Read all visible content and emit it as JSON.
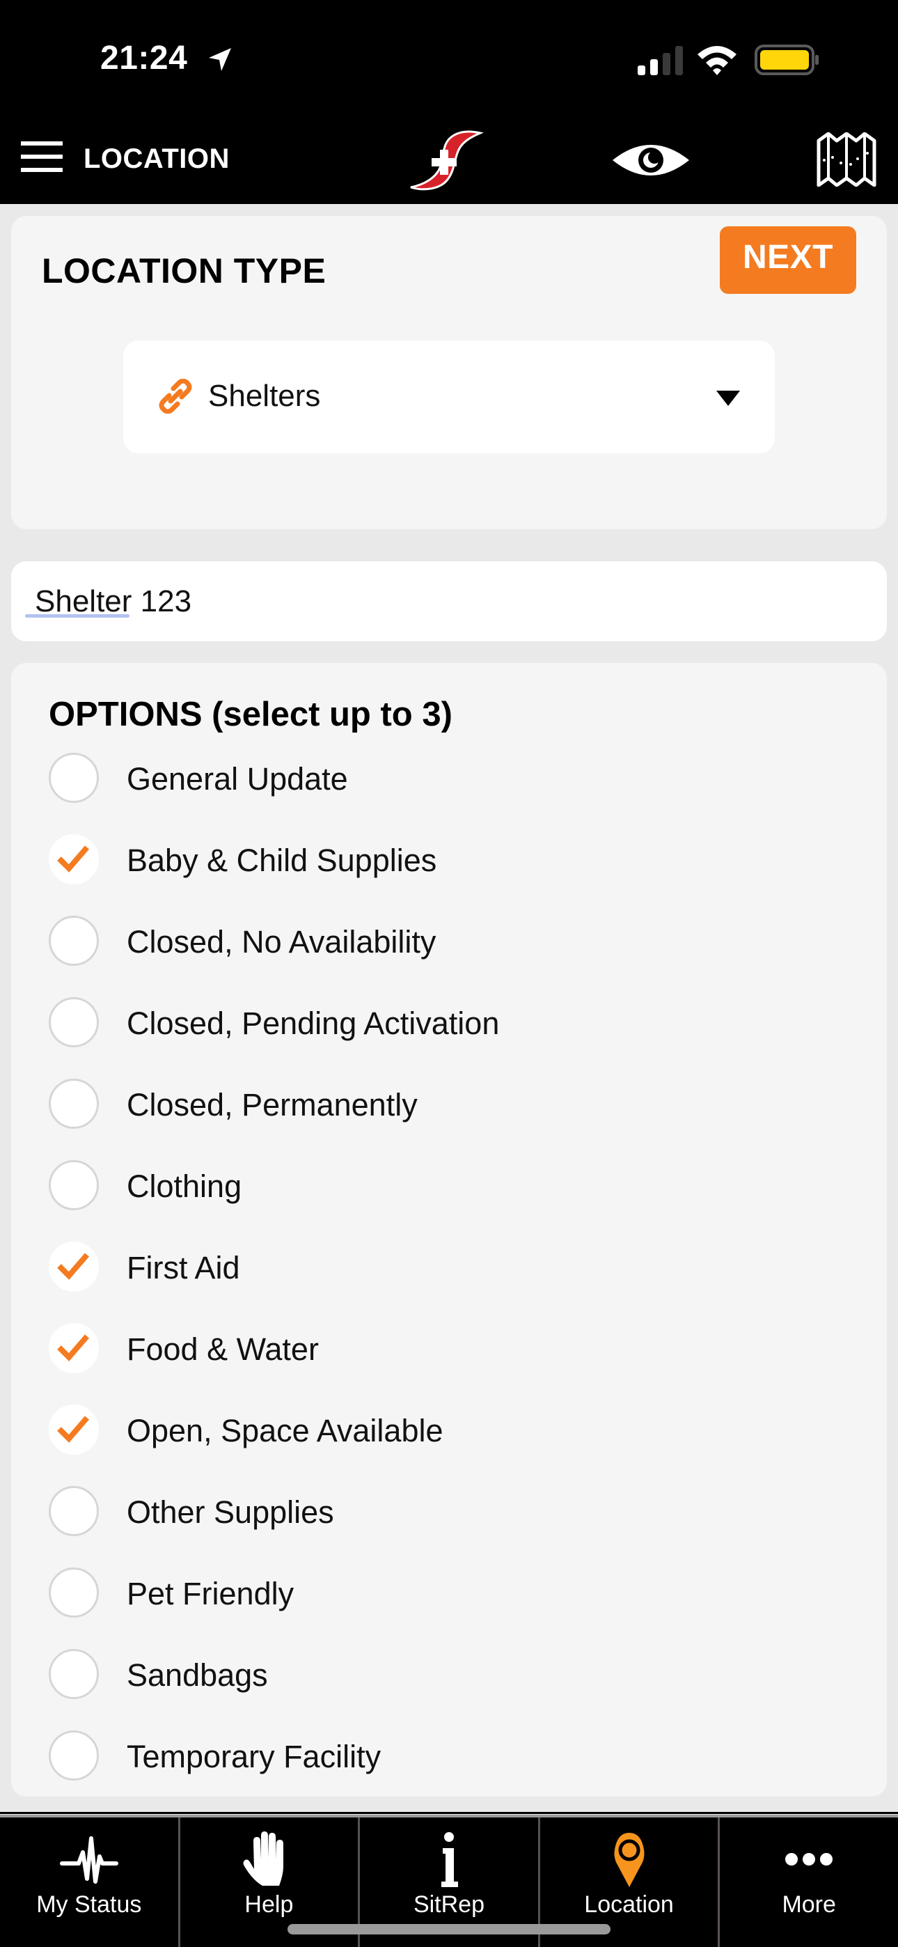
{
  "status_bar": {
    "time": "21:24",
    "battery_color": "#ffd60a"
  },
  "header": {
    "title": "LOCATION",
    "icons": [
      "menu-icon",
      "app-logo",
      "eye-icon",
      "map-icon"
    ]
  },
  "location_type": {
    "title": "LOCATION TYPE",
    "next_label": "NEXT",
    "selected": "Shelters",
    "dropdown_icon": "link-icon"
  },
  "name_field": {
    "value": "Shelter 123"
  },
  "options": {
    "title": "OPTIONS (select up to 3)",
    "items": [
      {
        "label": "General Update",
        "checked": false
      },
      {
        "label": "Baby & Child Supplies",
        "checked": true
      },
      {
        "label": "Closed, No Availability",
        "checked": false
      },
      {
        "label": "Closed, Pending Activation",
        "checked": false
      },
      {
        "label": "Closed, Permanently",
        "checked": false
      },
      {
        "label": "Clothing",
        "checked": false
      },
      {
        "label": "First Aid",
        "checked": true
      },
      {
        "label": "Food & Water",
        "checked": true
      },
      {
        "label": "Open, Space Available",
        "checked": true
      },
      {
        "label": "Other Supplies",
        "checked": false
      },
      {
        "label": "Pet Friendly",
        "checked": false
      },
      {
        "label": "Sandbags",
        "checked": false
      },
      {
        "label": "Temporary Facility",
        "checked": false
      }
    ]
  },
  "tabbar": {
    "items": [
      {
        "label": "My Status",
        "icon": "heartbeat-icon",
        "active": false
      },
      {
        "label": "Help",
        "icon": "hand-icon",
        "active": false
      },
      {
        "label": "SitRep",
        "icon": "info-icon",
        "active": false
      },
      {
        "label": "Location",
        "icon": "map-pin-icon",
        "active": true
      },
      {
        "label": "More",
        "icon": "more-dots-icon",
        "active": false
      }
    ]
  },
  "colors": {
    "accent": "#f47b20",
    "header_bg": "#000000",
    "card_bg": "#f5f5f5",
    "page_bg": "#e9e9e9",
    "logo_red": "#d6232a"
  }
}
